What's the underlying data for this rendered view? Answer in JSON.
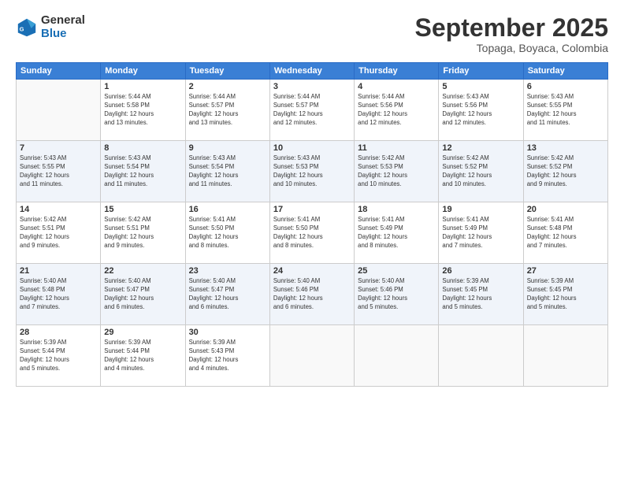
{
  "header": {
    "logo_general": "General",
    "logo_blue": "Blue",
    "month_title": "September 2025",
    "subtitle": "Topaga, Boyaca, Colombia"
  },
  "days_of_week": [
    "Sunday",
    "Monday",
    "Tuesday",
    "Wednesday",
    "Thursday",
    "Friday",
    "Saturday"
  ],
  "weeks": [
    [
      {
        "day": "",
        "info": ""
      },
      {
        "day": "1",
        "info": "Sunrise: 5:44 AM\nSunset: 5:58 PM\nDaylight: 12 hours\nand 13 minutes."
      },
      {
        "day": "2",
        "info": "Sunrise: 5:44 AM\nSunset: 5:57 PM\nDaylight: 12 hours\nand 13 minutes."
      },
      {
        "day": "3",
        "info": "Sunrise: 5:44 AM\nSunset: 5:57 PM\nDaylight: 12 hours\nand 12 minutes."
      },
      {
        "day": "4",
        "info": "Sunrise: 5:44 AM\nSunset: 5:56 PM\nDaylight: 12 hours\nand 12 minutes."
      },
      {
        "day": "5",
        "info": "Sunrise: 5:43 AM\nSunset: 5:56 PM\nDaylight: 12 hours\nand 12 minutes."
      },
      {
        "day": "6",
        "info": "Sunrise: 5:43 AM\nSunset: 5:55 PM\nDaylight: 12 hours\nand 11 minutes."
      }
    ],
    [
      {
        "day": "7",
        "info": "Sunrise: 5:43 AM\nSunset: 5:55 PM\nDaylight: 12 hours\nand 11 minutes."
      },
      {
        "day": "8",
        "info": "Sunrise: 5:43 AM\nSunset: 5:54 PM\nDaylight: 12 hours\nand 11 minutes."
      },
      {
        "day": "9",
        "info": "Sunrise: 5:43 AM\nSunset: 5:54 PM\nDaylight: 12 hours\nand 11 minutes."
      },
      {
        "day": "10",
        "info": "Sunrise: 5:43 AM\nSunset: 5:53 PM\nDaylight: 12 hours\nand 10 minutes."
      },
      {
        "day": "11",
        "info": "Sunrise: 5:42 AM\nSunset: 5:53 PM\nDaylight: 12 hours\nand 10 minutes."
      },
      {
        "day": "12",
        "info": "Sunrise: 5:42 AM\nSunset: 5:52 PM\nDaylight: 12 hours\nand 10 minutes."
      },
      {
        "day": "13",
        "info": "Sunrise: 5:42 AM\nSunset: 5:52 PM\nDaylight: 12 hours\nand 9 minutes."
      }
    ],
    [
      {
        "day": "14",
        "info": "Sunrise: 5:42 AM\nSunset: 5:51 PM\nDaylight: 12 hours\nand 9 minutes."
      },
      {
        "day": "15",
        "info": "Sunrise: 5:42 AM\nSunset: 5:51 PM\nDaylight: 12 hours\nand 9 minutes."
      },
      {
        "day": "16",
        "info": "Sunrise: 5:41 AM\nSunset: 5:50 PM\nDaylight: 12 hours\nand 8 minutes."
      },
      {
        "day": "17",
        "info": "Sunrise: 5:41 AM\nSunset: 5:50 PM\nDaylight: 12 hours\nand 8 minutes."
      },
      {
        "day": "18",
        "info": "Sunrise: 5:41 AM\nSunset: 5:49 PM\nDaylight: 12 hours\nand 8 minutes."
      },
      {
        "day": "19",
        "info": "Sunrise: 5:41 AM\nSunset: 5:49 PM\nDaylight: 12 hours\nand 7 minutes."
      },
      {
        "day": "20",
        "info": "Sunrise: 5:41 AM\nSunset: 5:48 PM\nDaylight: 12 hours\nand 7 minutes."
      }
    ],
    [
      {
        "day": "21",
        "info": "Sunrise: 5:40 AM\nSunset: 5:48 PM\nDaylight: 12 hours\nand 7 minutes."
      },
      {
        "day": "22",
        "info": "Sunrise: 5:40 AM\nSunset: 5:47 PM\nDaylight: 12 hours\nand 6 minutes."
      },
      {
        "day": "23",
        "info": "Sunrise: 5:40 AM\nSunset: 5:47 PM\nDaylight: 12 hours\nand 6 minutes."
      },
      {
        "day": "24",
        "info": "Sunrise: 5:40 AM\nSunset: 5:46 PM\nDaylight: 12 hours\nand 6 minutes."
      },
      {
        "day": "25",
        "info": "Sunrise: 5:40 AM\nSunset: 5:46 PM\nDaylight: 12 hours\nand 5 minutes."
      },
      {
        "day": "26",
        "info": "Sunrise: 5:39 AM\nSunset: 5:45 PM\nDaylight: 12 hours\nand 5 minutes."
      },
      {
        "day": "27",
        "info": "Sunrise: 5:39 AM\nSunset: 5:45 PM\nDaylight: 12 hours\nand 5 minutes."
      }
    ],
    [
      {
        "day": "28",
        "info": "Sunrise: 5:39 AM\nSunset: 5:44 PM\nDaylight: 12 hours\nand 5 minutes."
      },
      {
        "day": "29",
        "info": "Sunrise: 5:39 AM\nSunset: 5:44 PM\nDaylight: 12 hours\nand 4 minutes."
      },
      {
        "day": "30",
        "info": "Sunrise: 5:39 AM\nSunset: 5:43 PM\nDaylight: 12 hours\nand 4 minutes."
      },
      {
        "day": "",
        "info": ""
      },
      {
        "day": "",
        "info": ""
      },
      {
        "day": "",
        "info": ""
      },
      {
        "day": "",
        "info": ""
      }
    ]
  ]
}
